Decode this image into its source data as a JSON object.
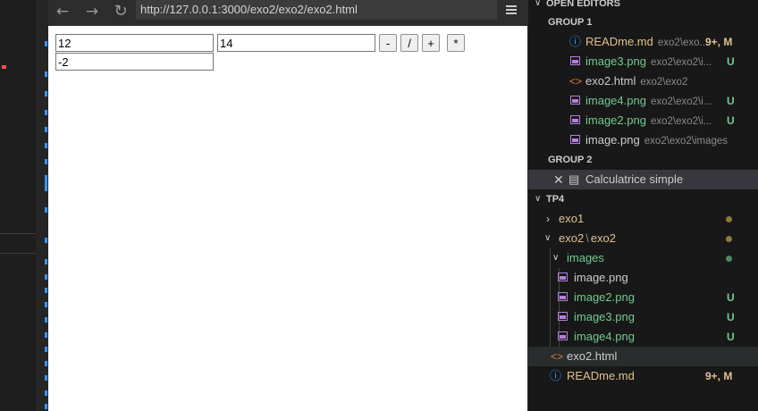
{
  "browser": {
    "url": "http://127.0.0.1:3000/exo2/exo2/exo2.html",
    "back_icon": "arrow-left-icon",
    "forward_icon": "arrow-right-icon",
    "reload_icon": "reload-icon",
    "menu_icon": "hamburger-menu-icon"
  },
  "calculator": {
    "input_a": "12",
    "input_b": "14",
    "result": "-2",
    "buttons": [
      "-",
      "/",
      "+",
      "*"
    ]
  },
  "explorer": {
    "open_editors_title": "OPEN EDITORS",
    "group1_title": "GROUP 1",
    "group1": [
      {
        "name": "READme.md",
        "path": "exo2\\exo...",
        "badge": "9+, M"
      },
      {
        "name": "image3.png",
        "path": "exo2\\exo2\\i...",
        "badge": "U"
      },
      {
        "name": "exo2.html",
        "path": "exo2\\exo2",
        "badge": ""
      },
      {
        "name": "image4.png",
        "path": "exo2\\exo2\\i...",
        "badge": "U"
      },
      {
        "name": "image2.png",
        "path": "exo2\\exo2\\i...",
        "badge": "U"
      },
      {
        "name": "image.png",
        "path": "exo2\\exo2\\images",
        "badge": ""
      }
    ],
    "group2_title": "GROUP 2",
    "group2": [
      {
        "name": "Calculatrice simple"
      }
    ],
    "project_title": "TP4",
    "tree": {
      "exo1": "exo1",
      "exo2_folder": "exo2",
      "exo2_separator": "\\",
      "exo2_sub": "exo2",
      "images": "images",
      "files_images": [
        {
          "name": "image.png",
          "badge": ""
        },
        {
          "name": "image2.png",
          "badge": "U"
        },
        {
          "name": "image3.png",
          "badge": "U"
        },
        {
          "name": "image4.png",
          "badge": "U"
        }
      ],
      "exo2_html": "exo2.html",
      "readme": "READme.md",
      "readme_badge": "9+, M"
    },
    "colors": {
      "untracked": "#73c991",
      "modified": "#e2c08d",
      "info": "#3794ff",
      "html": "#e37933",
      "image": "#b180d7"
    }
  }
}
